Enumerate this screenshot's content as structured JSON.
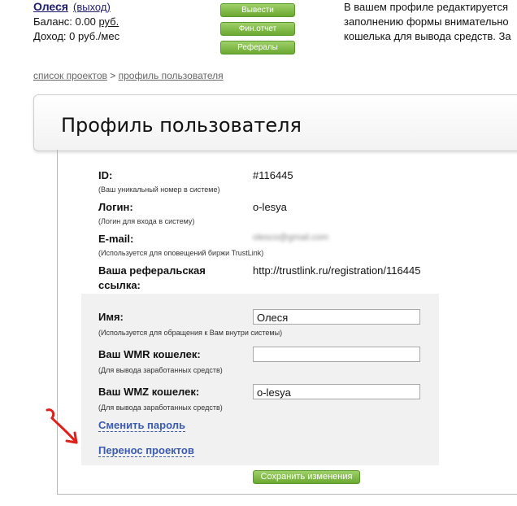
{
  "header": {
    "user_name": "Олеся",
    "logout": "(выход)",
    "balance_label": "Баланс:",
    "balance_value": "0.00",
    "balance_unit": "руб.",
    "income_label": "Доход:",
    "income_value": "0 руб./мес",
    "buttons": {
      "withdraw": "Вывести",
      "fin_report": "Фин.отчет",
      "referrals": "Рефералы"
    },
    "intro_lines": [
      "В вашем профиле редактируется",
      "заполнению формы внимательно",
      "кошелька для вывода средств. За"
    ]
  },
  "breadcrumb": {
    "projects": "список проектов",
    "separator": ">",
    "current": "профиль пользователя"
  },
  "page_title": "Профиль пользователя",
  "fields": {
    "id": {
      "label": "ID:",
      "hint": "(Ваш уникальный номер в системе)",
      "value": "#116445"
    },
    "login": {
      "label": "Логин:",
      "hint": "(Логин для входа в систему)",
      "value": "o-lesya"
    },
    "email": {
      "label": "E-mail:",
      "hint": "(Используется для оповещений биржи TrustLink)",
      "value": "olesco@gmail.com"
    },
    "ref": {
      "label_line1": "Ваша реферальская",
      "label_line2": "ссылка:",
      "value": "http://trustlink.ru/registration/116445"
    },
    "name": {
      "label": "Имя:",
      "hint": "(Используется для обращения к Вам внутри системы)",
      "value": "Олеся"
    },
    "wmr": {
      "label": "Ваш WMR кошелек:",
      "hint": "(Для вывода заработанных средств)",
      "value": ""
    },
    "wmz": {
      "label": "Ваш WMZ кошелек:",
      "hint": "(Для вывода заработанных средств)",
      "value": "o-lesya"
    }
  },
  "links": {
    "change_password": "Сменить пароль",
    "transfer_projects": "Перенос проектов"
  },
  "save_button": "Сохранить изменения",
  "colors": {
    "button_green": "#6aa830",
    "annotation_red": "#e0201a",
    "link_blue": "#3b5bb0"
  }
}
